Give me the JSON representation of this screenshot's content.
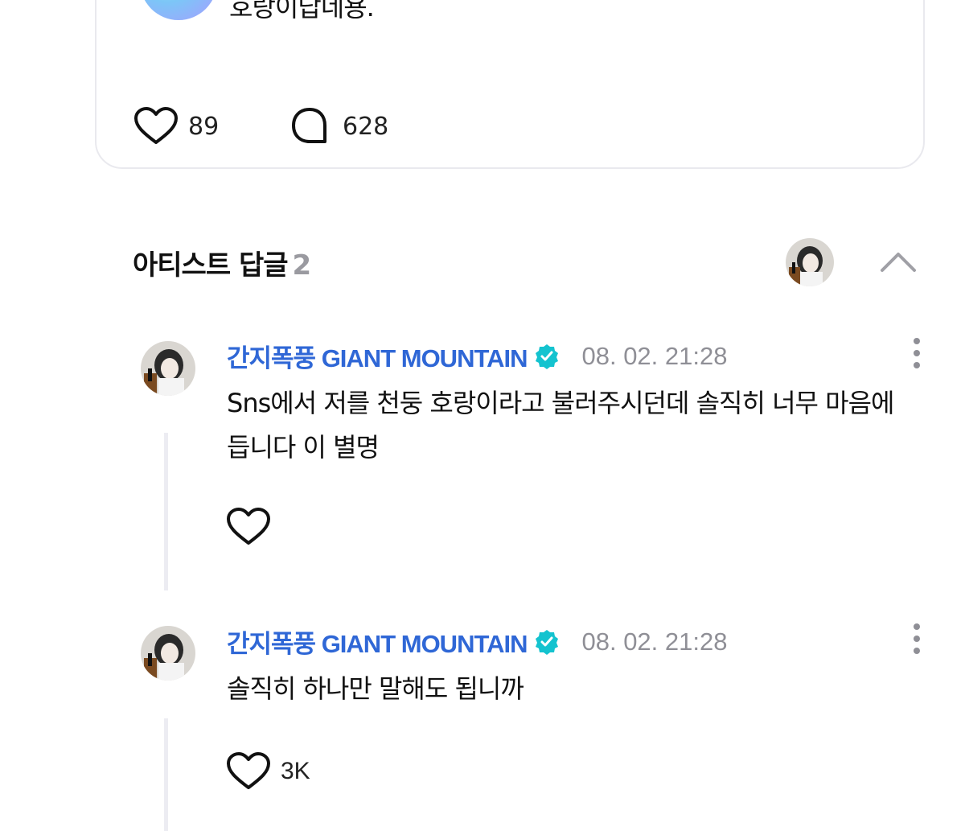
{
  "post": {
    "text": "호랑이답네용.",
    "likes": "89",
    "comments": "628"
  },
  "section": {
    "title": "아티스트 답글",
    "count": "2"
  },
  "replies": [
    {
      "author": "간지폭풍 GIANT MOUNTAIN",
      "timestamp": "08. 02. 21:28",
      "text": "Sns에서 저를 천둥 호랑이라고 불러주시던데 솔직히 너무 마음에 듭니다 이 별명",
      "likes": ""
    },
    {
      "author": "간지폭풍 GIANT MOUNTAIN",
      "timestamp": "08. 02. 21:28",
      "text": "솔직히 하나만 말해도 됩니까",
      "likes": "3K"
    }
  ],
  "colors": {
    "author": "#2f67d6",
    "verified": "#14c3cf",
    "muted": "#8f8f96",
    "border": "#e9e9ee",
    "thread_line": "#ececf2"
  }
}
